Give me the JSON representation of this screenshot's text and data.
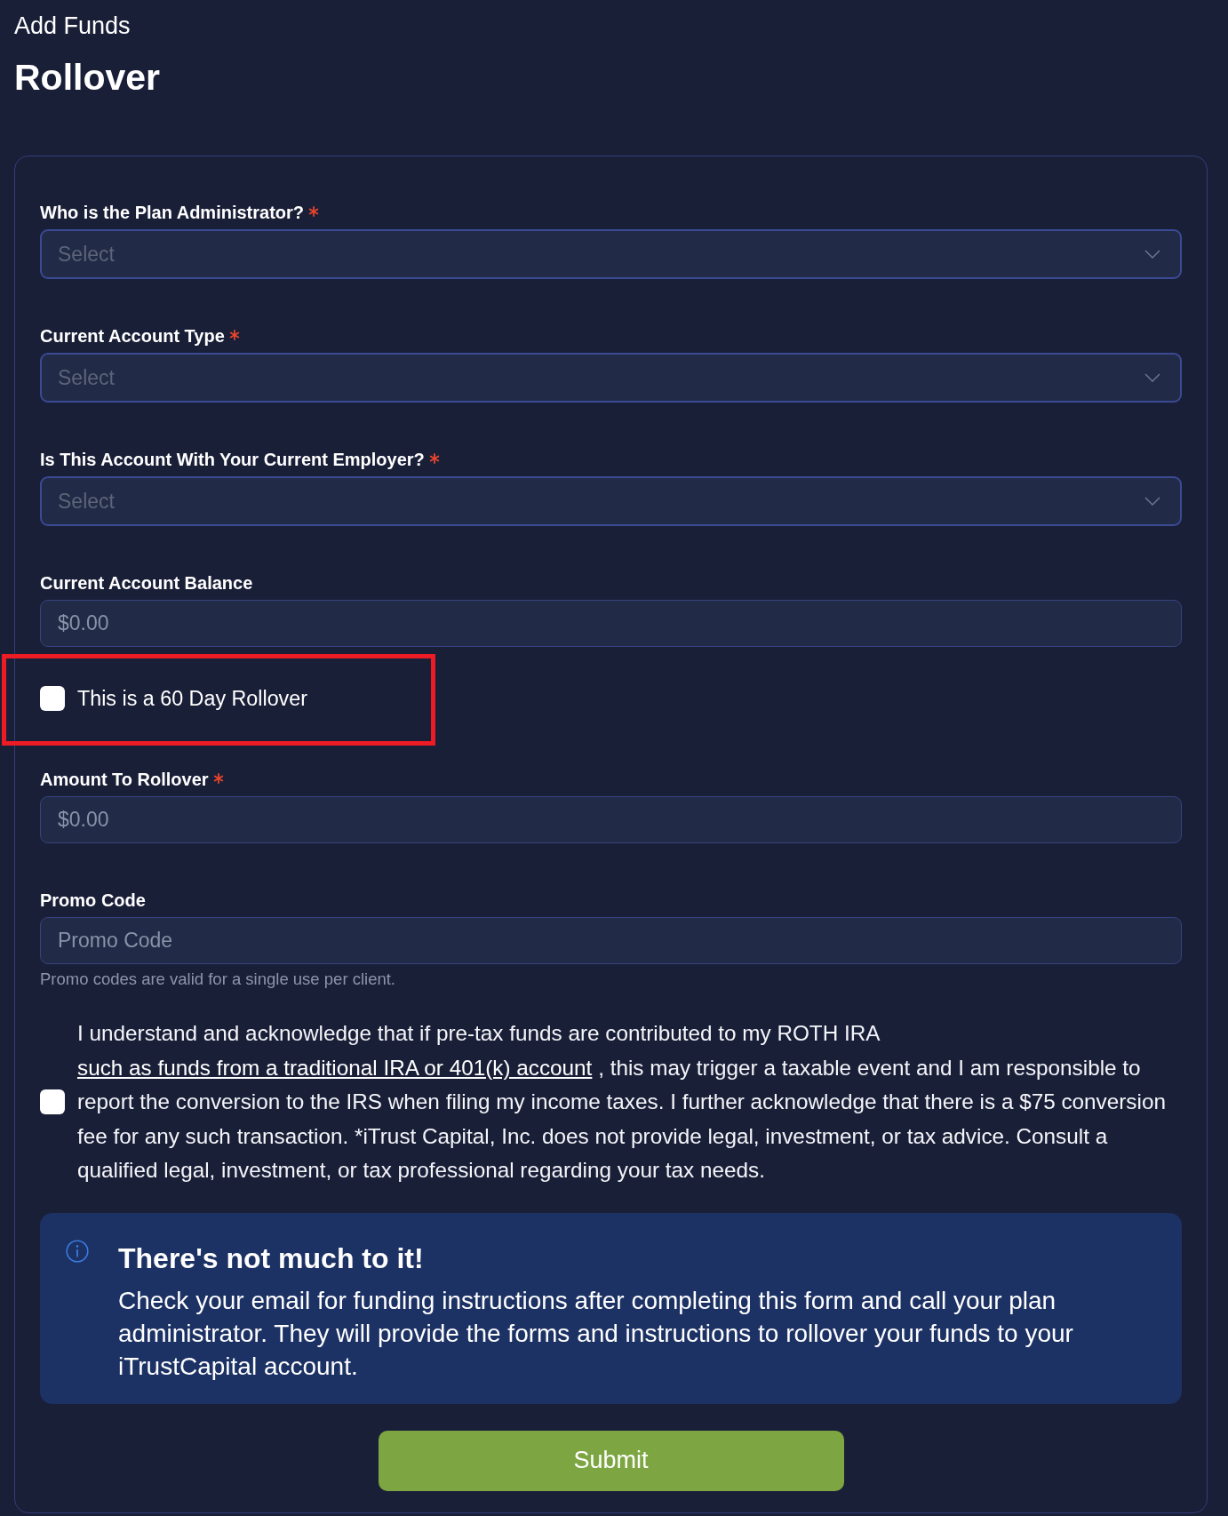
{
  "header": {
    "subtitle": "Add Funds",
    "title": "Rollover"
  },
  "form": {
    "fields": [
      {
        "kind": "select",
        "label": "Who is the Plan Administrator?",
        "required": true,
        "placeholder": "Select",
        "highlighted": false
      },
      {
        "kind": "select",
        "label": "Current Account Type",
        "required": true,
        "placeholder": "Select",
        "highlighted": false
      },
      {
        "kind": "select",
        "label": "Is This Account With Your Current Employer?",
        "required": true,
        "placeholder": "Select",
        "highlighted": false
      },
      {
        "kind": "input",
        "label": "Current Account Balance",
        "required": false,
        "placeholder": "$0.00",
        "highlighted": false
      },
      {
        "kind": "checkbox",
        "label": "This is a 60 Day Rollover",
        "checked": false,
        "highlighted": true
      },
      {
        "kind": "input",
        "label": "Amount To Rollover",
        "required": true,
        "placeholder": "$0.00",
        "highlighted": false
      },
      {
        "kind": "input",
        "label": "Promo Code",
        "required": false,
        "placeholder": "Promo Code",
        "hint": "Promo codes are valid for a single use per client.",
        "highlighted": false
      },
      {
        "kind": "consent",
        "checked": false,
        "text_before": "I understand and acknowledge that if pre-tax funds are contributed to my ROTH IRA",
        "link": "such as funds from a traditional IRA or 401(k) account",
        "text_after": ", this may trigger a taxable event and I am responsible to report the conversion to the IRS when filing my income taxes. I further acknowledge that there is a $75 conversion fee for any such transaction. *iTrust Capital, Inc. does not provide legal, investment, or tax advice. Consult a qualified legal, investment, or tax professional regarding your tax needs.",
        "highlighted": false
      }
    ],
    "notice": {
      "title": "There's not much to it!",
      "body": "Check your email for funding instructions after completing this form and call your plan administrator. They will provide the forms and instructions to rollover your funds to your iTrustCapital account."
    },
    "submit_button": "Submit"
  }
}
